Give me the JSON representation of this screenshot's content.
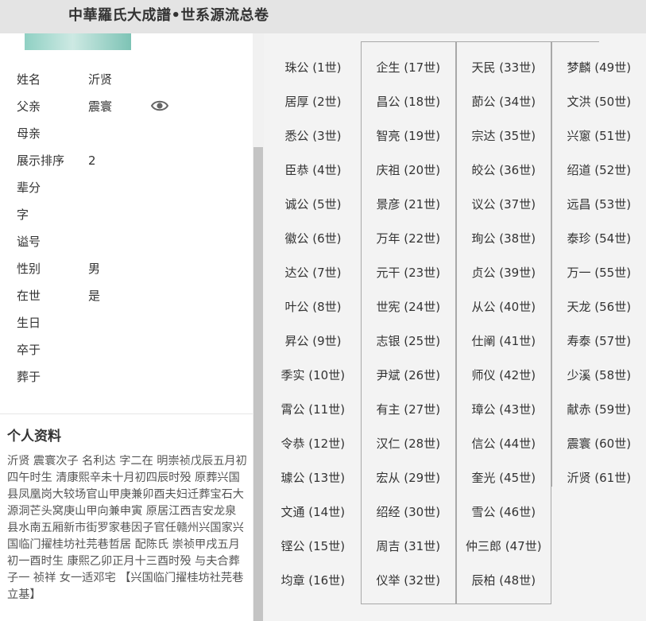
{
  "app": {
    "title": "中華羅氏大成譜•世系源流总卷"
  },
  "profile": {
    "fields": [
      {
        "label": "姓名",
        "value": "沂贤"
      },
      {
        "label": "父亲",
        "value": "震寰"
      },
      {
        "label": "母亲",
        "value": ""
      },
      {
        "label": "展示排序",
        "value": "2"
      },
      {
        "label": "辈分",
        "value": ""
      },
      {
        "label": "字",
        "value": ""
      },
      {
        "label": "谥号",
        "value": ""
      },
      {
        "label": "性别",
        "value": "男"
      },
      {
        "label": "在世",
        "value": "是"
      },
      {
        "label": "生日",
        "value": ""
      },
      {
        "label": "卒于",
        "value": ""
      },
      {
        "label": "葬于",
        "value": ""
      }
    ],
    "view_icon": "eye-icon"
  },
  "bio": {
    "title": "个人资料",
    "text": "沂贤 震寰次子 名利达 字二在 明崇祯戊辰五月初四午时生 清康熙辛未十月初四辰时殁 原葬兴国县凤凰岗大较场官山甲庚兼卯酉夫妇迁葬宝石大源洞芒头窝庚山甲向兼申寅 原居江西吉安龙泉县水南五厢新市街罗家巷因子官任赣州兴国家兴国临门擢桂坊社芫巷哲居 配陈氏 崇祯甲戌五月初一酉时生 康熙乙卯正月十三酉时殁 与夫合葬 子一 祯祥 女一适邓宅 【兴国临门擢桂坊社芫巷立基】"
  },
  "lineage": {
    "columns": [
      [
        "珠公 (1世)",
        "居厚 (2世)",
        "悉公 (3世)",
        "臣恭 (4世)",
        "诚公 (5世)",
        "徽公 (6世)",
        "达公 (7世)",
        "叶公 (8世)",
        "昇公 (9世)",
        "季实 (10世)",
        "霄公 (11世)",
        "令恭 (12世)",
        "璩公 (13世)",
        "文通 (14世)",
        "铿公 (15世)",
        "均章 (16世)"
      ],
      [
        "企生 (17世)",
        "昌公 (18世)",
        "智亮 (19世)",
        "庆祖 (20世)",
        "景彦 (21世)",
        "万年 (22世)",
        "元干 (23世)",
        "世宪 (24世)",
        "志银 (25世)",
        "尹斌 (26世)",
        "有主 (27世)",
        "汉仁 (28世)",
        "宏从 (29世)",
        "绍经 (30世)",
        "周吉 (31世)",
        "仪举 (32世)"
      ],
      [
        "天民 (33世)",
        "莭公 (34世)",
        "宗达 (35世)",
        "皎公 (36世)",
        "议公 (37世)",
        "珣公 (38世)",
        "贞公 (39世)",
        "从公 (40世)",
        "仕阐 (41世)",
        "师仪 (42世)",
        "璋公 (43世)",
        "信公 (44世)",
        "奎光 (45世)",
        "雪公 (46世)",
        "仲三郎 (47世)",
        "辰柏 (48世)"
      ],
      [
        "梦麟 (49世)",
        "文洪 (50世)",
        "兴窻 (51世)",
        "绍道 (52世)",
        "远昌 (53世)",
        "泰珍 (54世)",
        "万一 (55世)",
        "天龙 (56世)",
        "寿泰 (57世)",
        "少溪 (58世)",
        "献赤 (59世)",
        "震寰 (60世)",
        "沂贤 (61世)"
      ]
    ]
  }
}
